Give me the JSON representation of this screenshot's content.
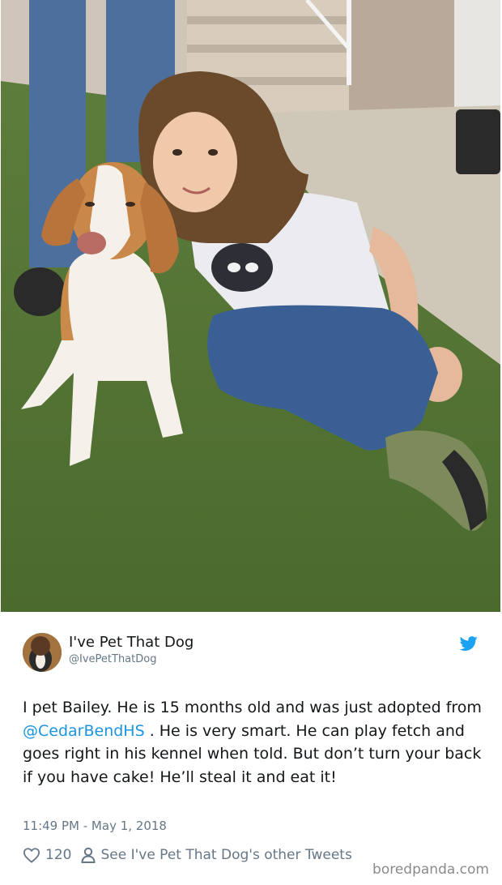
{
  "photo": {
    "icon": "photo-girl-with-beagle"
  },
  "tweet": {
    "author": {
      "display_name": "I've Pet That Dog",
      "handle": "@IvePetThatDog",
      "avatar_icon": "dog-avatar"
    },
    "text": {
      "part1": "I pet Bailey. He is 15 months old and was just adopted from ",
      "mention": "@CedarBendHS",
      "part2": " . He is very smart. He can play fetch and goes right in his kennel when told. But don’t turn your back if you have cake! He’ll steal it and eat it!"
    },
    "timestamp": "11:49 PM - May 1, 2018",
    "likes": "120",
    "profile_link": "See I've Pet That Dog's other Tweets"
  },
  "watermark": "boredpanda.com",
  "colors": {
    "link": "#1b95e0",
    "twitter_blue": "#1da1f2",
    "muted": "#657786",
    "text": "#14171a"
  }
}
